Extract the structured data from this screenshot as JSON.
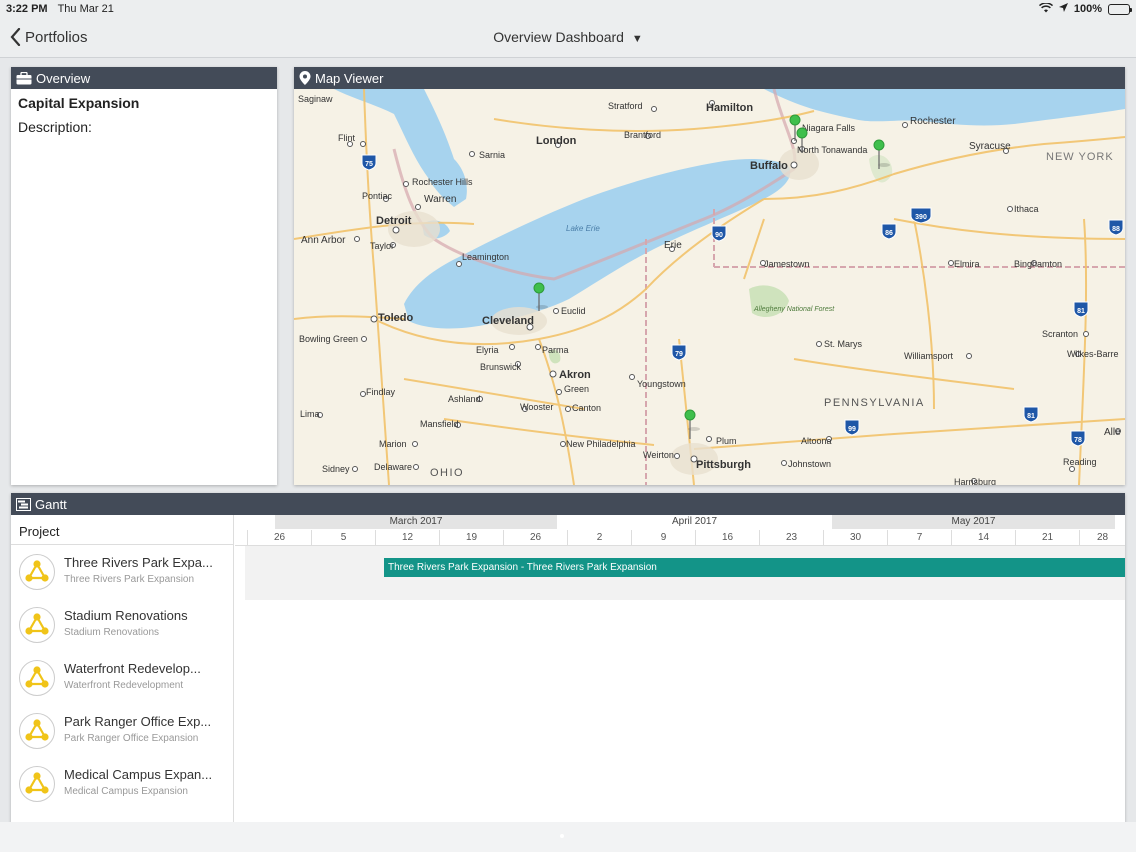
{
  "status": {
    "time": "3:22 PM",
    "date": "Thu Mar 21",
    "battery": "100%"
  },
  "nav": {
    "back_label": "Portfolios",
    "title": "Overview Dashboard"
  },
  "overview": {
    "header": "Overview",
    "title": "Capital Expansion",
    "description_label": "Description:"
  },
  "map": {
    "header": "Map Viewer",
    "labels": {
      "saginaw": "Saginaw",
      "stratford": "Stratford",
      "hamilton": "Hamilton",
      "rochester": "Rochester",
      "flint": "Flint",
      "london": "London",
      "brantford": "Brantford",
      "niagara": "Niagara Falls",
      "ntonawanda": "North Tonawanda",
      "syracuse": "Syracuse",
      "newyork": "NEW YORK",
      "sarnia": "Sarnia",
      "buffalo": "Buffalo",
      "rochhills": "Rochester Hills",
      "pontiac": "Pontiac",
      "warren": "Warren",
      "detroit": "Detroit",
      "ithaca": "Ithaca",
      "annarbor": "Ann Arbor",
      "taylor": "Taylor",
      "lakeerie": "Lake Erie",
      "erie": "Erie",
      "jamestown": "Jamestown",
      "elmira": "Elmira",
      "binghamton": "Binghamton",
      "leamington": "Leamington",
      "toledo": "Toledo",
      "euclid": "Euclid",
      "cleveland": "Cleveland",
      "allegheny": "Allegheny National Forest",
      "scranton": "Scranton",
      "bowling": "Bowling Green",
      "elyria": "Elyria",
      "parma": "Parma",
      "stmarys": "St. Marys",
      "williamsport": "Williamsport",
      "wilkes": "Wilkes-Barre",
      "brunswick": "Brunswick",
      "akron": "Akron",
      "youngstown": "Youngstown",
      "findlay": "Findlay",
      "green": "Green",
      "ashland": "Ashland",
      "pennsylvania": "PENNSYLVANIA",
      "lima": "Lima",
      "wooster": "Wooster",
      "canton": "Canton",
      "mansfield": "Mansfield",
      "plum": "Plum",
      "altoona": "Altoona",
      "allen": "Alle",
      "marion": "Marion",
      "newphil": "New Philadelphia",
      "weirton": "Weirton",
      "pittsburgh": "Pittsburgh",
      "delaware": "Delaware",
      "sidney": "Sidney",
      "ohio": "OHIO",
      "johnstown": "Johnstown",
      "reading": "Reading",
      "harrisburg": "Harrisburg"
    },
    "shields": {
      "i75": "75",
      "i90": "90",
      "i390": "390",
      "i86": "86",
      "i88": "88",
      "i79": "79",
      "i81a": "81",
      "i81b": "81",
      "i99": "99",
      "i78": "78"
    }
  },
  "gantt": {
    "header": "Gantt",
    "project_col": "Project",
    "months": [
      "March 2017",
      "April 2017",
      "May 2017"
    ],
    "days": [
      "26",
      "5",
      "12",
      "19",
      "26",
      "2",
      "9",
      "16",
      "23",
      "30",
      "7",
      "14",
      "21",
      "28"
    ],
    "projects": [
      {
        "name": "Three Rivers Park Expa...",
        "sub": "Three Rivers Park Expansion"
      },
      {
        "name": "Stadium Renovations",
        "sub": "Stadium Renovations"
      },
      {
        "name": "Waterfront Redevelop...",
        "sub": "Waterfront Redevelopment"
      },
      {
        "name": "Park Ranger Office Exp...",
        "sub": "Park Ranger Office Expansion"
      },
      {
        "name": "Medical Campus Expan...",
        "sub": "Medical Campus Expansion"
      }
    ],
    "bar_label": "Three Rivers Park Expansion - Three Rivers Park Expansion",
    "bar_color": "#139488",
    "icon_color": "#f0c419"
  },
  "colors": {
    "header_bg": "#434b58",
    "water": "#a7d3ee",
    "land": "#f6f2e6",
    "pin": "#3fbf4c"
  }
}
